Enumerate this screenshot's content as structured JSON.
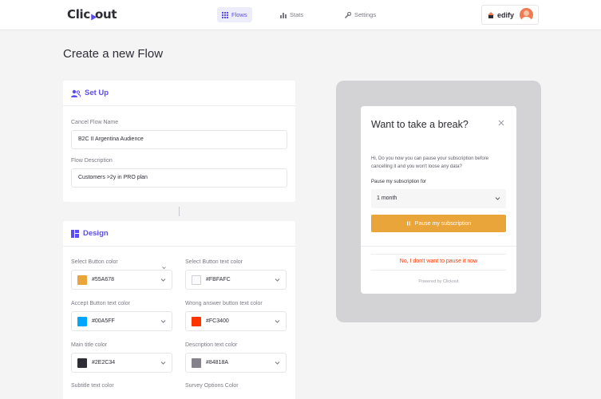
{
  "header": {
    "logo_left": "Clic",
    "logo_right": "out",
    "nav": [
      {
        "label": "Flows",
        "icon": "grid-icon",
        "active": true
      },
      {
        "label": "Stats",
        "icon": "bar-chart-icon",
        "active": false
      },
      {
        "label": "Settings",
        "icon": "wrench-icon",
        "active": false
      }
    ],
    "brand": "edify"
  },
  "page": {
    "title": "Create a new Flow"
  },
  "setup": {
    "title": "Set Up",
    "name_label": "Cancel Flow Name",
    "name_value": "B2C II Argentina Audience",
    "desc_label": "Flow Description",
    "desc_value": "Customers >2y in PRO plan"
  },
  "design": {
    "title": "Design",
    "colors": [
      {
        "label": "Select Button color",
        "value": "#55A678",
        "swatch": "#e9a43a"
      },
      {
        "label": "Select Button text color",
        "value": "#FBFAFC",
        "swatch": "#FBFAFC"
      },
      {
        "label": "Accept Button text color",
        "value": "#00A5FF",
        "swatch": "#00A5FF"
      },
      {
        "label": "Wrong answer button text color",
        "value": "#FC3400",
        "swatch": "#FC3400"
      },
      {
        "label": "Main title color",
        "value": "#2E2C34",
        "swatch": "#2E2C34"
      },
      {
        "label": "Description text color",
        "value": "#84818A",
        "swatch": "#84818A"
      },
      {
        "label": "Subtitle text color",
        "value": "",
        "swatch": ""
      },
      {
        "label": "Survey Options Color",
        "value": "",
        "swatch": ""
      }
    ]
  },
  "preview": {
    "title": "Want to take a break?",
    "description": "Hi, Do you now you can pause your subscription before cancelling it and you won't loose any data?",
    "pause_label": "Pause my subscription for",
    "pause_value": "1 month",
    "pause_button": "Pause my subscription",
    "decline": "No, I don't want to pause it now",
    "powered_by": "Powered by Clickout"
  },
  "colors": {
    "accent": "#5b4cf0",
    "pause_button": "#e9a43a",
    "decline_text": "#fc3400"
  }
}
